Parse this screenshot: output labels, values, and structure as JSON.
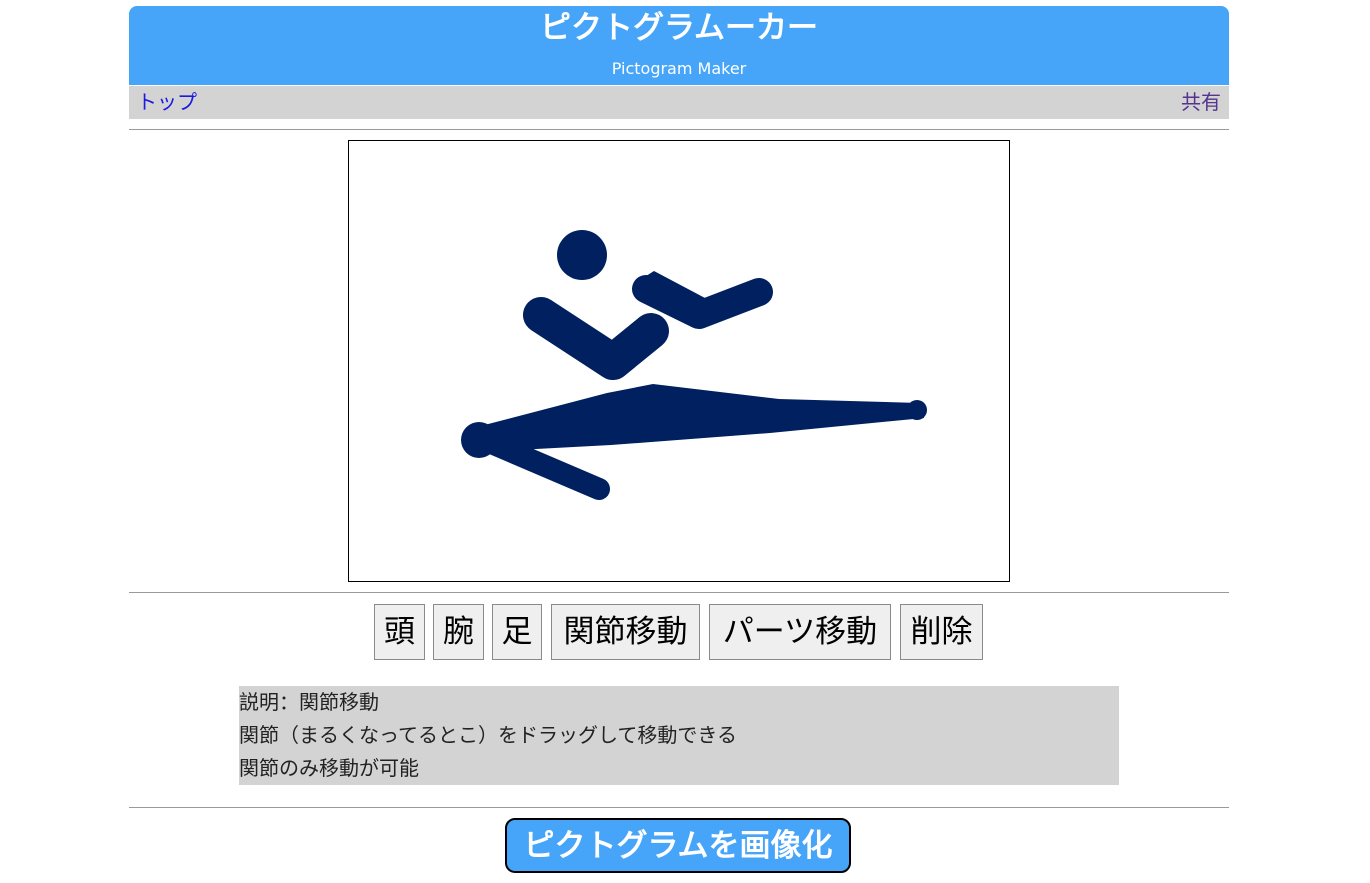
{
  "header": {
    "title": "ピクトグラムーカー",
    "subtitle": "Pictogram Maker",
    "color": "#46a5f9"
  },
  "nav": {
    "home": "トップ",
    "share": "共有"
  },
  "pictogram": {
    "fill": "#002060"
  },
  "toolbar": {
    "head": "頭",
    "arm": "腕",
    "leg": "足",
    "move_joint": "関節移動",
    "move_part": "パーツ移動",
    "delete": "削除"
  },
  "description": {
    "line1": "説明：関節移動",
    "line2": "関節（まるくなってるとこ）をドラッグして移動できる",
    "line3": "関節のみ移動が可能"
  },
  "export": {
    "label": "ピクトグラムを画像化"
  }
}
